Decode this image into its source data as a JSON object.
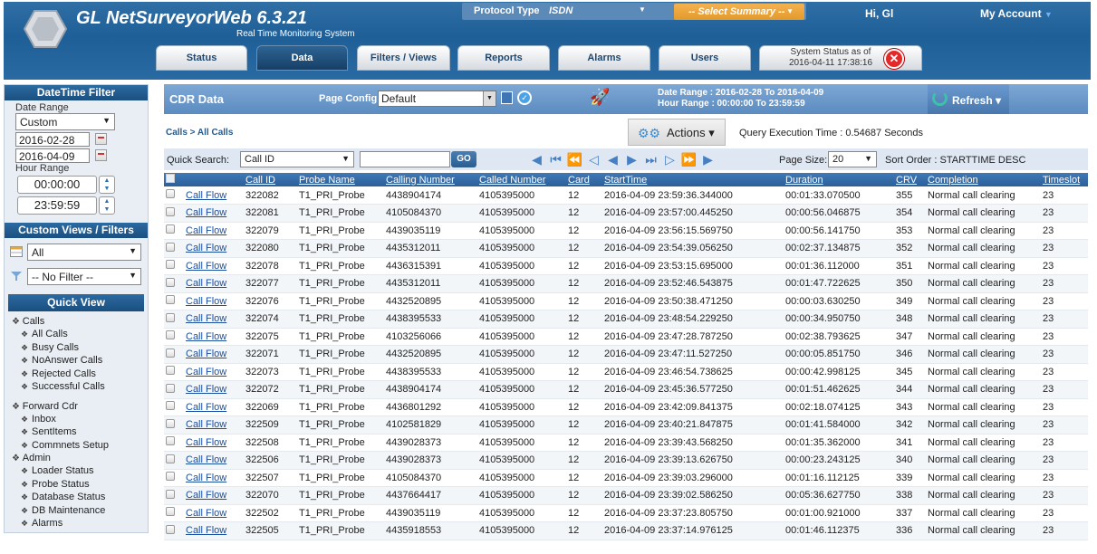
{
  "header": {
    "app_title": "GL NetSurveyorWeb 6.3.21",
    "app_subtitle": "Real Time Monitoring System",
    "protocol_label": "Protocol Type",
    "protocol_value": "ISDN",
    "summary_placeholder": "-- Select Summary --",
    "greeting": "Hi, Gl",
    "my_account": "My Account",
    "tabs": [
      "Status",
      "Data",
      "Filters / Views",
      "Reports",
      "Alarms",
      "Users"
    ],
    "active_tab": "Data",
    "system_status_line1": "System Status as of",
    "system_status_line2": "2016-04-11 17:38:16"
  },
  "sidebar": {
    "datetime_title": "DateTime Filter",
    "date_range_label": "Date Range",
    "date_range_value": "Custom",
    "start_date": "2016-02-28",
    "end_date": "2016-04-09",
    "hour_range_label": "Hour Range",
    "start_time": "00:00:00",
    "end_time": "23:59:59",
    "custom_views_title": "Custom Views / Filters",
    "view_value": "All",
    "filter_value": "-- No Filter --",
    "quick_view_title": "Quick View",
    "groups": [
      {
        "name": "Calls",
        "items": [
          "All Calls",
          "Busy Calls",
          "NoAnswer Calls",
          "Rejected Calls",
          "Successful Calls"
        ]
      },
      {
        "name": "Forward Cdr",
        "items": [
          "Inbox",
          "SentItems",
          "Commnets Setup"
        ]
      },
      {
        "name": "Admin",
        "items": [
          "Loader Status",
          "Probe Status",
          "Database Status",
          "DB Maintenance",
          "Alarms"
        ]
      }
    ]
  },
  "main": {
    "title": "CDR Data",
    "page_config_label": "Page Config",
    "page_config_value": "Default",
    "date_range_text": "Date Range : 2016-02-28 To 2016-04-09",
    "hour_range_text": "Hour Range : 00:00:00 To 23:59:59",
    "refresh_label": "Refresh",
    "breadcrumb": "Calls > All Calls",
    "actions_label": "Actions",
    "query_time": "Query Execution Time : 0.54687 Seconds",
    "quick_search_label": "Quick Search:",
    "quick_search_field": "Call ID",
    "go_label": "GO",
    "page_size_label": "Page Size:",
    "page_size_value": "20",
    "sort_order": "Sort Order : STARTTIME DESC"
  },
  "table": {
    "columns": [
      "",
      "",
      "Call ID",
      "Probe Name",
      "Calling Number",
      "Called Number",
      "Card",
      "StartTime",
      "Duration",
      "CRV",
      "Completion",
      "Timeslot"
    ],
    "link_label": "Call Flow",
    "rows": [
      [
        "322082",
        "T1_PRI_Probe",
        "4438904174",
        "4105395000",
        "12",
        "2016-04-09 23:59:36.344000",
        "00:01:33.070500",
        "355",
        "Normal call clearing",
        "23"
      ],
      [
        "322081",
        "T1_PRI_Probe",
        "4105084370",
        "4105395000",
        "12",
        "2016-04-09 23:57:00.445250",
        "00:00:56.046875",
        "354",
        "Normal call clearing",
        "23"
      ],
      [
        "322079",
        "T1_PRI_Probe",
        "4439035119",
        "4105395000",
        "12",
        "2016-04-09 23:56:15.569750",
        "00:00:56.141750",
        "353",
        "Normal call clearing",
        "23"
      ],
      [
        "322080",
        "T1_PRI_Probe",
        "4435312011",
        "4105395000",
        "12",
        "2016-04-09 23:54:39.056250",
        "00:02:37.134875",
        "352",
        "Normal call clearing",
        "23"
      ],
      [
        "322078",
        "T1_PRI_Probe",
        "4436315391",
        "4105395000",
        "12",
        "2016-04-09 23:53:15.695000",
        "00:01:36.112000",
        "351",
        "Normal call clearing",
        "23"
      ],
      [
        "322077",
        "T1_PRI_Probe",
        "4435312011",
        "4105395000",
        "12",
        "2016-04-09 23:52:46.543875",
        "00:01:47.722625",
        "350",
        "Normal call clearing",
        "23"
      ],
      [
        "322076",
        "T1_PRI_Probe",
        "4432520895",
        "4105395000",
        "12",
        "2016-04-09 23:50:38.471250",
        "00:00:03.630250",
        "349",
        "Normal call clearing",
        "23"
      ],
      [
        "322074",
        "T1_PRI_Probe",
        "4438395533",
        "4105395000",
        "12",
        "2016-04-09 23:48:54.229250",
        "00:00:34.950750",
        "348",
        "Normal call clearing",
        "23"
      ],
      [
        "322075",
        "T1_PRI_Probe",
        "4103256066",
        "4105395000",
        "12",
        "2016-04-09 23:47:28.787250",
        "00:02:38.793625",
        "347",
        "Normal call clearing",
        "23"
      ],
      [
        "322071",
        "T1_PRI_Probe",
        "4432520895",
        "4105395000",
        "12",
        "2016-04-09 23:47:11.527250",
        "00:00:05.851750",
        "346",
        "Normal call clearing",
        "23"
      ],
      [
        "322073",
        "T1_PRI_Probe",
        "4438395533",
        "4105395000",
        "12",
        "2016-04-09 23:46:54.738625",
        "00:00:42.998125",
        "345",
        "Normal call clearing",
        "23"
      ],
      [
        "322072",
        "T1_PRI_Probe",
        "4438904174",
        "4105395000",
        "12",
        "2016-04-09 23:45:36.577250",
        "00:01:51.462625",
        "344",
        "Normal call clearing",
        "23"
      ],
      [
        "322069",
        "T1_PRI_Probe",
        "4436801292",
        "4105395000",
        "12",
        "2016-04-09 23:42:09.841375",
        "00:02:18.074125",
        "343",
        "Normal call clearing",
        "23"
      ],
      [
        "322509",
        "T1_PRI_Probe",
        "4102581829",
        "4105395000",
        "12",
        "2016-04-09 23:40:21.847875",
        "00:01:41.584000",
        "342",
        "Normal call clearing",
        "23"
      ],
      [
        "322508",
        "T1_PRI_Probe",
        "4439028373",
        "4105395000",
        "12",
        "2016-04-09 23:39:43.568250",
        "00:01:35.362000",
        "341",
        "Normal call clearing",
        "23"
      ],
      [
        "322506",
        "T1_PRI_Probe",
        "4439028373",
        "4105395000",
        "12",
        "2016-04-09 23:39:13.626750",
        "00:00:23.243125",
        "340",
        "Normal call clearing",
        "23"
      ],
      [
        "322507",
        "T1_PRI_Probe",
        "4105084370",
        "4105395000",
        "12",
        "2016-04-09 23:39:03.296000",
        "00:01:16.112125",
        "339",
        "Normal call clearing",
        "23"
      ],
      [
        "322070",
        "T1_PRI_Probe",
        "4437664417",
        "4105395000",
        "12",
        "2016-04-09 23:39:02.586250",
        "00:05:36.627750",
        "338",
        "Normal call clearing",
        "23"
      ],
      [
        "322502",
        "T1_PRI_Probe",
        "4439035119",
        "4105395000",
        "12",
        "2016-04-09 23:37:23.805750",
        "00:01:00.921000",
        "337",
        "Normal call clearing",
        "23"
      ],
      [
        "322505",
        "T1_PRI_Probe",
        "4435918553",
        "4105395000",
        "12",
        "2016-04-09 23:37:14.976125",
        "00:01:46.112375",
        "336",
        "Normal call clearing",
        "23"
      ]
    ]
  }
}
